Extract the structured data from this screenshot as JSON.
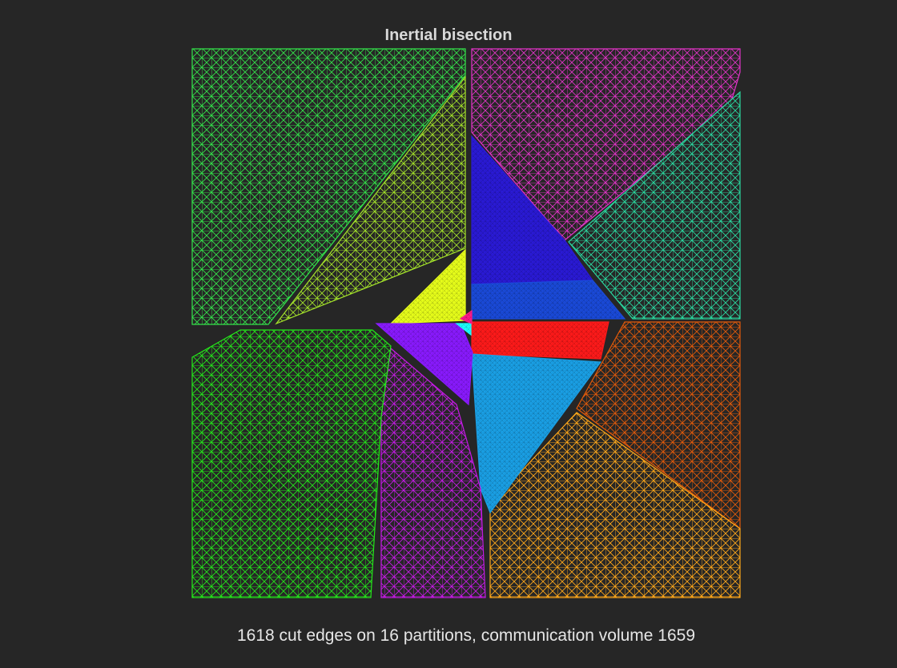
{
  "figure": {
    "title": "Inertial bisection",
    "caption": "1618 cut edges on 16 partitions, communication volume 1659"
  },
  "colors": {
    "background": "#262626",
    "title_text": "#d9d9d9",
    "caption_text": "#e6e6e6"
  },
  "partitions": [
    {
      "id": 1,
      "color": "#33e34a",
      "shade": "mesh"
    },
    {
      "id": 2,
      "color": "#a4e32a",
      "shade": "mesh"
    },
    {
      "id": 3,
      "color": "#e8ff1a",
      "shade": "dense"
    },
    {
      "id": 4,
      "color": "#e233c8",
      "shade": "mesh"
    },
    {
      "id": 5,
      "color": "#2ad9a0",
      "shade": "mesh"
    },
    {
      "id": 6,
      "color": "#2a1ad6",
      "shade": "dense"
    },
    {
      "id": 7,
      "color": "#1a4ad9",
      "shade": "dense"
    },
    {
      "id": 8,
      "color": "#ff1a1a",
      "shade": "dense"
    },
    {
      "id": 9,
      "color": "#e35a0a",
      "shade": "mesh"
    },
    {
      "id": 10,
      "color": "#ffa81a",
      "shade": "mesh"
    },
    {
      "id": 11,
      "color": "#1aa0e6",
      "shade": "dense"
    },
    {
      "id": 12,
      "color": "#c61ae6",
      "shade": "mesh"
    },
    {
      "id": 13,
      "color": "#8a1aff",
      "shade": "dense"
    },
    {
      "id": 14,
      "color": "#24e61a",
      "shade": "mesh"
    },
    {
      "id": 15,
      "color": "#1affff",
      "shade": "dense"
    },
    {
      "id": 16,
      "color": "#ff1a8a",
      "shade": "dense"
    }
  ]
}
